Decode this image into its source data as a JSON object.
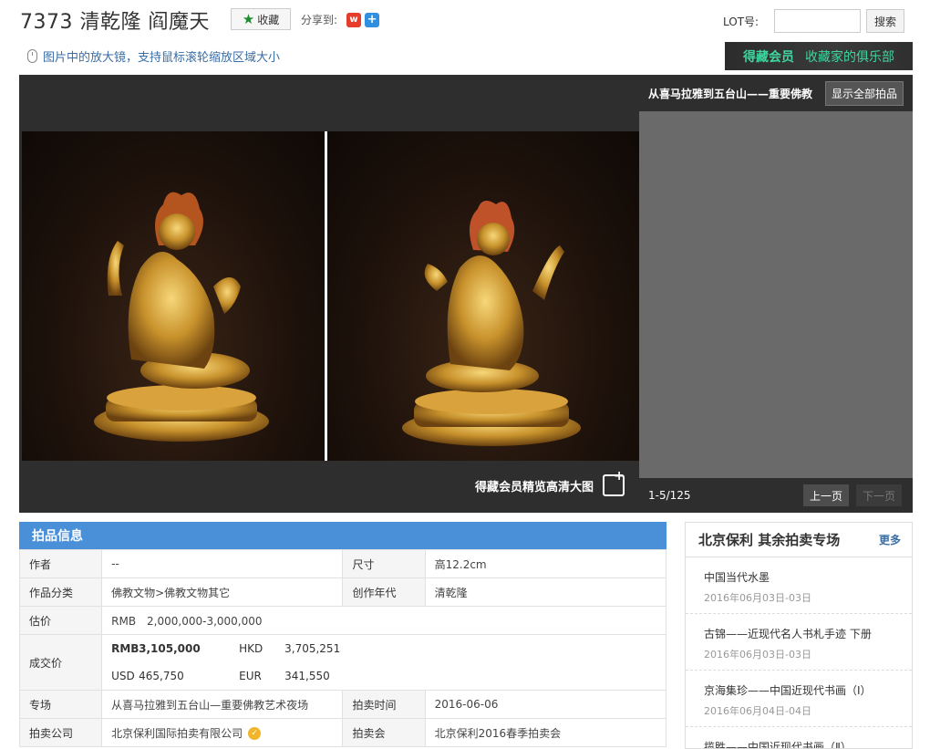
{
  "header": {
    "title": "7373 清乾隆 阎魔天",
    "favorite_label": "收藏",
    "share_label": "分享到:",
    "weibo_icon": "weibo-icon",
    "share_more_icon": "plus-icon",
    "lot_label": "LOT号:",
    "lot_placeholder": "",
    "search_label": "搜索"
  },
  "magnifier_hint": "图片中的放大镜，支持鼠标滚轮缩放区域大小",
  "member_banner": {
    "a": "得藏会员",
    "b": "收藏家的俱乐部"
  },
  "viewer": {
    "hd_label": "得藏会员精览高清大图"
  },
  "related": {
    "title": "从喜马拉雅到五台山——重要佛教",
    "show_all": "显示全部拍品",
    "pagination": "1-5/125",
    "prev": "上一页",
    "next": "下一页"
  },
  "info": {
    "heading": "拍品信息",
    "author_label": "作者",
    "author": "--",
    "size_label": "尺寸",
    "size": "高12.2cm",
    "category_label": "作品分类",
    "category": "佛教文物>佛教文物其它",
    "year_label": "创作年代",
    "year": "清乾隆",
    "estimate_label": "估价",
    "estimate": "RMB　2,000,000-3,000,000",
    "deal_label": "成交价",
    "deal": {
      "rmb_cur": "RMB",
      "rmb": "3,105,000",
      "hkd_cur": "HKD",
      "hkd": "3,705,251",
      "usd_cur": "USD",
      "usd": "465,750",
      "eur_cur": "EUR",
      "eur": "341,550"
    },
    "session_label": "专场",
    "session": "从喜马拉雅到五台山—重要佛教艺术夜场",
    "time_label": "拍卖时间",
    "time": "2016-06-06",
    "company_label": "拍卖公司",
    "company": "北京保利国际拍卖有限公司",
    "auction_label": "拍卖会",
    "auction": "北京保利2016春季拍卖会"
  },
  "other": {
    "title": "北京保利 其余拍卖专场",
    "more": "更多",
    "items": [
      {
        "name": "中国当代水墨",
        "date": "2016年06月03日-03日"
      },
      {
        "name": "古锦——近现代名人书札手迹 下册",
        "date": "2016年06月03日-03日"
      },
      {
        "name": "京海集珍——中国近现代书画（Ⅰ）",
        "date": "2016年06月04日-04日"
      },
      {
        "name": "揽胜——中国近现代书画（Ⅱ）",
        "date": ""
      }
    ]
  },
  "colors": {
    "accent": "#4a90d9",
    "estimate_red": "#dd3333",
    "member_green": "#3fd6a0"
  }
}
